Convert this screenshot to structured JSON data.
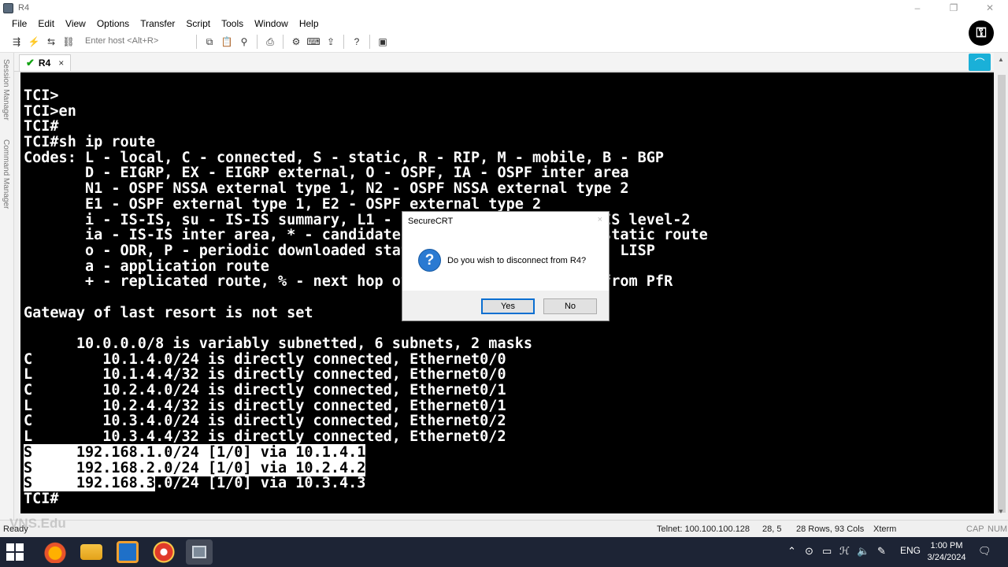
{
  "window": {
    "title": "R4"
  },
  "menu": [
    "File",
    "Edit",
    "View",
    "Options",
    "Transfer",
    "Script",
    "Tools",
    "Window",
    "Help"
  ],
  "toolbar": {
    "host_placeholder": "Enter host <Alt+R>"
  },
  "side_labels": {
    "session_manager": "Session Manager",
    "command_manager": "Command Manager"
  },
  "tab": {
    "label": "R4",
    "close": "×"
  },
  "terminal": {
    "lines": [
      "TCI>",
      "TCI>en",
      "TCI#",
      "TCI#sh ip route",
      "Codes: L - local, C - connected, S - static, R - RIP, M - mobile, B - BGP",
      "       D - EIGRP, EX - EIGRP external, O - OSPF, IA - OSPF inter area",
      "       N1 - OSPF NSSA external type 1, N2 - OSPF NSSA external type 2",
      "       E1 - OSPF external type 1, E2 - OSPF external type 2",
      "       i - IS-IS, su - IS-IS summary, L1 - IS-IS level-1, L2 - IS-IS level-2",
      "       ia - IS-IS inter area, * - candidate default, U - per-user static route",
      "       o - ODR, P - periodic downloaded static route, H - NHRP, l - LISP",
      "       a - application route",
      "       + - replicated route, % - next hop override, p - overrides from PfR",
      "",
      "Gateway of last resort is not set",
      "",
      "      10.0.0.0/8 is variably subnetted, 6 subnets, 2 masks",
      "C        10.1.4.0/24 is directly connected, Ethernet0/0",
      "L        10.1.4.4/32 is directly connected, Ethernet0/0",
      "C        10.2.4.0/24 is directly connected, Ethernet0/1",
      "L        10.2.4.4/32 is directly connected, Ethernet0/1",
      "C        10.3.4.0/24 is directly connected, Ethernet0/2",
      "L        10.3.4.4/32 is directly connected, Ethernet0/2",
      "S     192.168.1.0/24 [1/0] via 10.1.4.1",
      "S     192.168.2.0/24 [1/0] via 10.2.4.2",
      "S     192.168.3.0/24 [1/0] via 10.3.4.3",
      "TCI#"
    ],
    "highlight": [
      {
        "line": 23,
        "start": 0,
        "end": 39
      },
      {
        "line": 24,
        "start": 0,
        "end": 39
      },
      {
        "line": 25,
        "start": 0,
        "end": 15
      }
    ]
  },
  "dialog": {
    "title": "SecureCRT",
    "close": "×",
    "icon": "?",
    "message": "Do you wish to disconnect from R4?",
    "yes": "Yes",
    "no": "No"
  },
  "status": {
    "ready": "Ready",
    "connection": "Telnet: 100.100.100.128",
    "cursor": "28,  5",
    "size": "28 Rows, 93 Cols",
    "emulation": "Xterm",
    "caps": "CAP",
    "num": "NUM"
  },
  "watermark": "VNS.Edu",
  "taskbar": {
    "lang": "ENG",
    "time": "1:00 PM",
    "date": "3/24/2024"
  },
  "icons": {
    "logo": "lock-badge-icon",
    "tray": [
      "chevron-up-icon",
      "network-icon",
      "battery-icon",
      "ime-icon",
      "speaker-icon",
      "pen-icon"
    ]
  },
  "colors": {
    "terminal_bg": "#000000",
    "terminal_fg": "#ffffff",
    "accent": "#0b6fd1",
    "taskbar": "#1d2435"
  }
}
